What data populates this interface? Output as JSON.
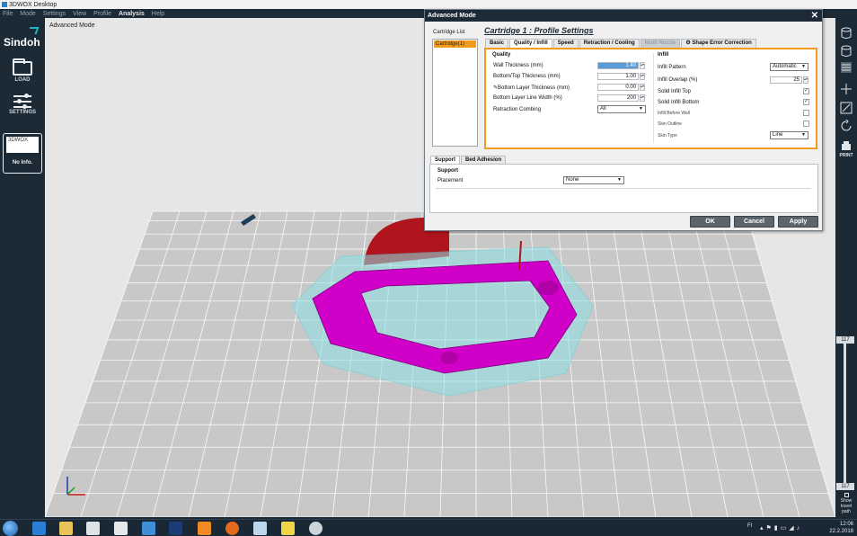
{
  "window": {
    "title": "3DWOX Desktop"
  },
  "menu": [
    "File",
    "Mode",
    "Settings",
    "View",
    "Profile",
    "Analysis",
    "Help"
  ],
  "menu_active": "Analysis",
  "brand": "Sindoh",
  "sidebar": {
    "load_label": "LOAD",
    "settings_label": "SETTINGS",
    "device_name": "3DWOX",
    "device_info": "No Info."
  },
  "viewport": {
    "mode_label": "Advanced Mode"
  },
  "rightbar": {
    "print_label": "PRINT",
    "layer_top": "117",
    "layer_bottom": "117",
    "travel_label": "Show travel path"
  },
  "dialog": {
    "title": "Advanced Mode",
    "cartridge_list_label": "Cartridge List",
    "cartridge_item": "Cartridge(1)",
    "profile_title": "Cartridge 1 : Profile Settings",
    "tabs": [
      "Basic",
      "Quality / Infill",
      "Speed",
      "Retraction / Cooling",
      "Multi Nozzle",
      "Shape Error Correction"
    ],
    "quality": {
      "title": "Quality",
      "wall_thickness_label": "Wall Thickness (mm)",
      "wall_thickness": "1.40",
      "bt_thickness_label": "Bottom/Top Thickness (mm)",
      "bt_thickness": "1.00",
      "bottom_layer_label": "Bottom Layer Thickness (mm)",
      "bottom_layer": "0.00",
      "bottom_width_label": "Bottom Layer Line Width (%)",
      "bottom_width": "200",
      "retraction_combing_label": "Retraction Combing",
      "retraction_combing": "All"
    },
    "infill": {
      "title": "Infill",
      "pattern_label": "Infill Pattern",
      "pattern": "Automatic",
      "overlap_label": "Infill Overlap (%)",
      "overlap": "25",
      "solid_top_label": "Solid Infill Top",
      "solid_bottom_label": "Solid Infill Bottom",
      "before_wall_label": "Infill Before Wall",
      "skin_outline_label": "Skin Outline",
      "skin_type_label": "Skin Type",
      "skin_type": "Line"
    },
    "tabs2": [
      "Support",
      "Bed Adhesion"
    ],
    "support": {
      "title": "Support",
      "placement_label": "Placement",
      "placement": "None"
    },
    "buttons": {
      "ok": "OK",
      "cancel": "Cancel",
      "apply": "Apply"
    }
  },
  "taskbar": {
    "lang": "FI",
    "time": "12:06",
    "date": "22.2.2018"
  },
  "colors": {
    "model": "#d000c8",
    "support_outline": "#5fd3dc",
    "accent": "#f39b1e",
    "sidebar": "#1c2a36"
  }
}
